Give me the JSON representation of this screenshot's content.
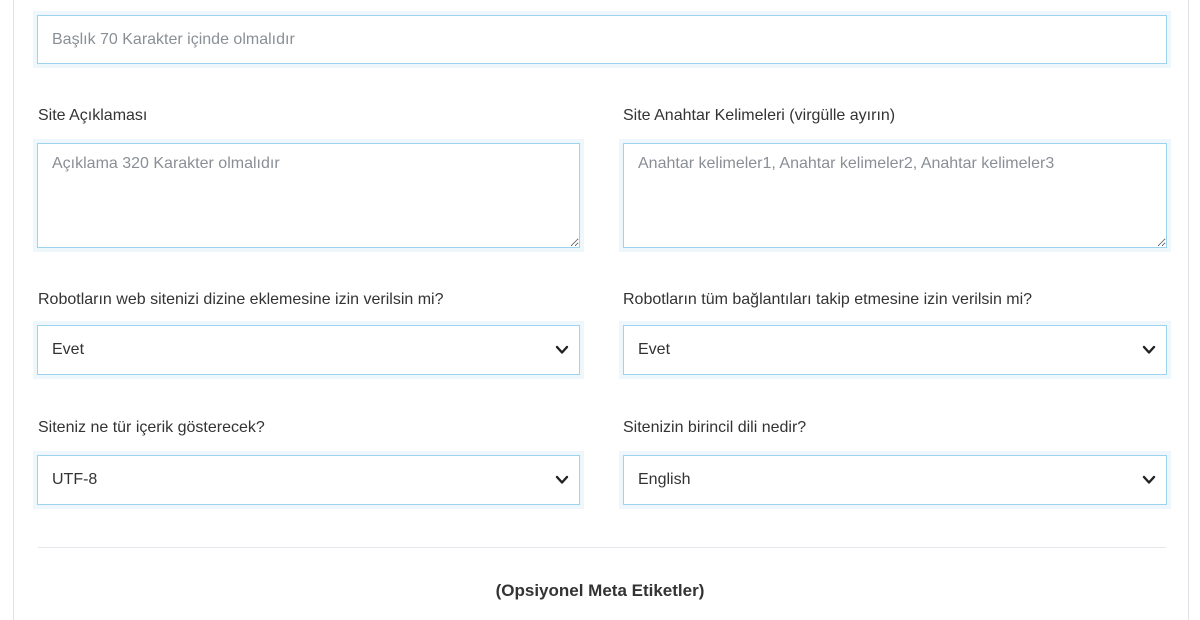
{
  "title_input": {
    "placeholder": "Başlık 70 Karakter içinde olmalıdır",
    "value": ""
  },
  "description": {
    "label": "Site Açıklaması",
    "placeholder": "Açıklama 320 Karakter olmalıdır"
  },
  "keywords": {
    "label": "Site Anahtar Kelimeleri (virgülle ayırın)",
    "placeholder": "Anahtar kelimeler1, Anahtar kelimeler2, Anahtar kelimeler3"
  },
  "robots_index": {
    "label": "Robotların web sitenizi dizine eklemesine izin verilsin mi?",
    "selected": "Evet"
  },
  "robots_follow": {
    "label": "Robotların tüm bağlantıları takip etmesine izin verilsin mi?",
    "selected": "Evet"
  },
  "content_type": {
    "label": "Siteniz ne tür içerik gösterecek?",
    "selected": "UTF-8"
  },
  "primary_language": {
    "label": "Sitenizin birincil dili nedir?",
    "selected": "English"
  },
  "optional_section": {
    "title": "(Opsiyonel Meta Etiketler)"
  },
  "colors": {
    "field_border": "#9ed3ef",
    "field_halo": "#eef7fc",
    "placeholder": "#8a8f96",
    "text": "#333333"
  },
  "icons": {
    "select_arrow": "chevron-down-icon",
    "textarea_resize": "resize-handle-icon"
  }
}
